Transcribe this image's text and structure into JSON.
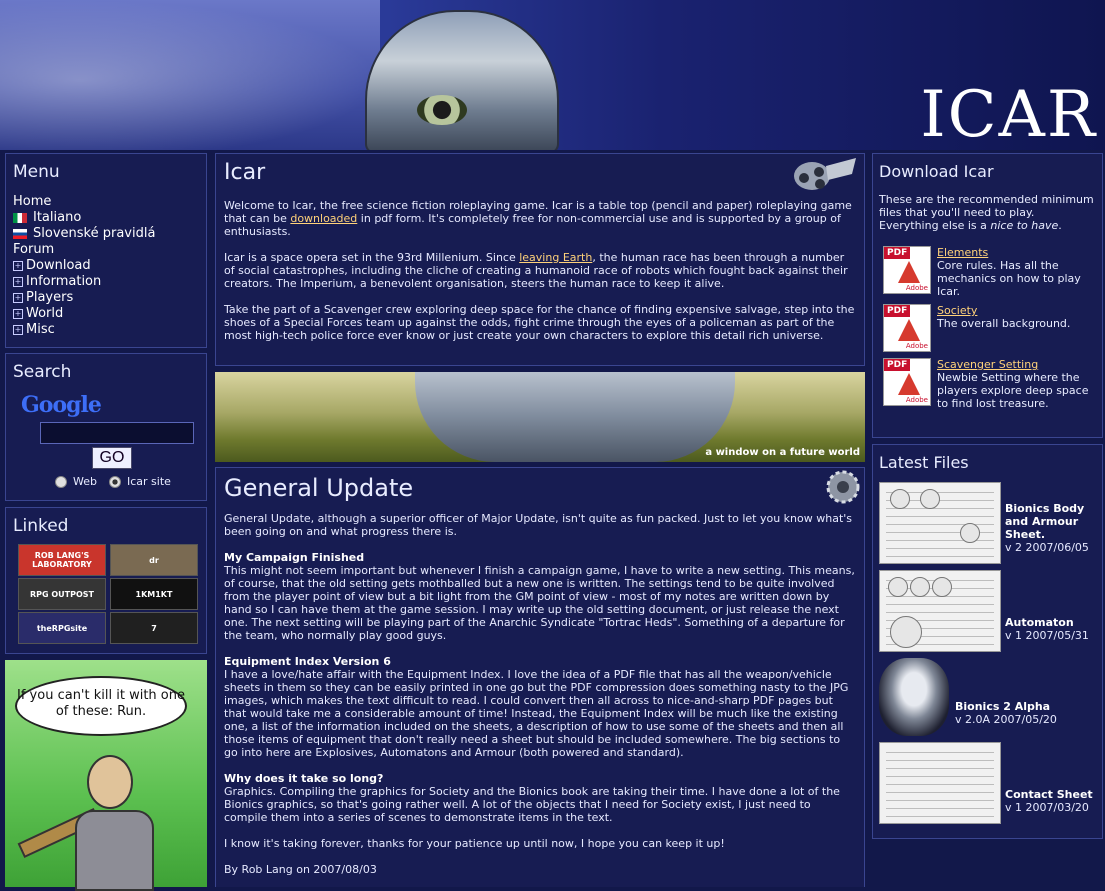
{
  "site": {
    "title": "ICAR"
  },
  "menu": {
    "heading": "Menu",
    "items": [
      {
        "label": "Home",
        "icon": ""
      },
      {
        "label": "Italiano",
        "icon": "flag-it-icon"
      },
      {
        "label": "Slovenské pravidlá",
        "icon": "flag-sk-icon"
      },
      {
        "label": "Forum",
        "icon": ""
      },
      {
        "label": "Download",
        "icon": "plus-icon"
      },
      {
        "label": "Information",
        "icon": "plus-icon"
      },
      {
        "label": "Players",
        "icon": "plus-icon"
      },
      {
        "label": "World",
        "icon": "plus-icon"
      },
      {
        "label": "Misc",
        "icon": "plus-icon"
      }
    ]
  },
  "search": {
    "heading": "Search",
    "google_logo": "Google",
    "input_value": "",
    "button_label": "GO",
    "options": [
      {
        "label": "Web",
        "selected": false
      },
      {
        "label": "Icar site",
        "selected": true
      }
    ]
  },
  "linked": {
    "heading": "Linked",
    "links": [
      {
        "label": "ROB LANG'S LABORATORY",
        "color": "#c9352c"
      },
      {
        "label": "dr",
        "color": "#7a6a52"
      },
      {
        "label": "RPG OUTPOST",
        "color": "#353535"
      },
      {
        "label": "1KM1KT",
        "color": "#111111"
      },
      {
        "label": "theRPGsite",
        "color": "#2a2c6a"
      },
      {
        "label": "7",
        "color": "#202020"
      }
    ]
  },
  "cartoon": {
    "speech": "If you can't kill it with one of these: Run."
  },
  "intro": {
    "title": "Icar",
    "p1_pre": "Welcome to Icar, the free science fiction roleplaying game. Icar is a table top (pencil and paper) roleplaying game that can be ",
    "p1_link": "downloaded",
    "p1_post": " in pdf form. It's completely free for non-commercial use and is supported by a group of enthusiasts.",
    "p2_pre": "Icar is a space opera set in the 93rd Millenium. Since ",
    "p2_link": "leaving Earth",
    "p2_post": ", the human race has been through a number of social catastrophes, including the cliche of creating a humanoid race of robots which fought back against their creators. The Imperium, a benevolent organisation, steers the human race to keep it alive.",
    "p3": "Take the part of a Scavenger crew exploring deep space for the chance of finding expensive salvage, step into the shoes of a Special Forces team up against the odds, fight crime through the eyes of a policeman as part of the most high-tech police force ever know or just create your own characters to explore this detail rich universe."
  },
  "banner": {
    "caption": "a window on a future world"
  },
  "update": {
    "title": "General Update",
    "lead": "General Update, although a superior officer of Major Update, isn't quite as fun packed. Just to let you know what's been going on and what progress there is.",
    "s1_title": "My Campaign Finished",
    "s1_body": "This might not seem important but whenever I finish a campaign game, I have to write a new setting. This means, of course, that the old setting gets mothballed but a new one is written. The settings tend to be quite involved from the player point of view but a bit light from the GM point of view - most of my notes are written down by hand so I can have them at the game session. I may write up the old setting document, or just release the next one. The next setting will be playing part of the Anarchic Syndicate \"Tortrac Heds\". Something of a departure for the team, who normally play good guys.",
    "s2_title": "Equipment Index Version 6",
    "s2_body": "I have a love/hate affair with the Equipment Index. I love the idea of a PDF file that has all the weapon/vehicle sheets in them so they can be easily printed in one go but the PDF compression does something nasty to the JPG images, which makes the text difficult to read. I could convert then all across to nice-and-sharp PDF pages but that would take me a considerable amount of time! Instead, the Equipment Index will be much like the existing one, a list of the information included on the sheets, a description of how to use some of the sheets and then all those items of equipment that don't really need a sheet but should be included somewhere. The big sections to go into here are Explosives, Automatons and Armour (both powered and standard).",
    "s3_title": "Why does it take so long?",
    "s3_body": "Graphics. Compiling the graphics for Society and the Bionics book are taking their time. I have done a lot of the Bionics graphics, so that's going rather well. A lot of the objects that I need for Society exist, I just need to compile them into a series of scenes to demonstrate items in the text.",
    "closing": "I know it's taking forever, thanks for your patience up until now, I hope you can keep it up!",
    "byline": "By Rob Lang on 2007/08/03"
  },
  "download": {
    "heading": "Download Icar",
    "intro_pre": "These are the recommended minimum files that you'll need to play. Everything else is a ",
    "intro_em": "nice to have",
    "intro_post": ".",
    "pdf_tag": "PDF",
    "pdf_brand": "Adobe",
    "items": [
      {
        "title": "Elements",
        "desc": "Core rules. Has all the mechanics on how to play Icar."
      },
      {
        "title": "Society",
        "desc": "The overall background."
      },
      {
        "title": "Scavenger Setting",
        "desc": "Newbie Setting where the players explore deep space to find lost treasure."
      }
    ]
  },
  "latest": {
    "heading": "Latest Files",
    "files": [
      {
        "name": "Bionics Body and Armour Sheet.",
        "version": "v 2 2007/06/05"
      },
      {
        "name": "Automaton",
        "version": "v 1 2007/05/31"
      },
      {
        "name": "Bionics 2 Alpha",
        "version": "v 2.0A 2007/05/20"
      },
      {
        "name": "Contact Sheet",
        "version": "v 1 2007/03/20"
      }
    ]
  }
}
